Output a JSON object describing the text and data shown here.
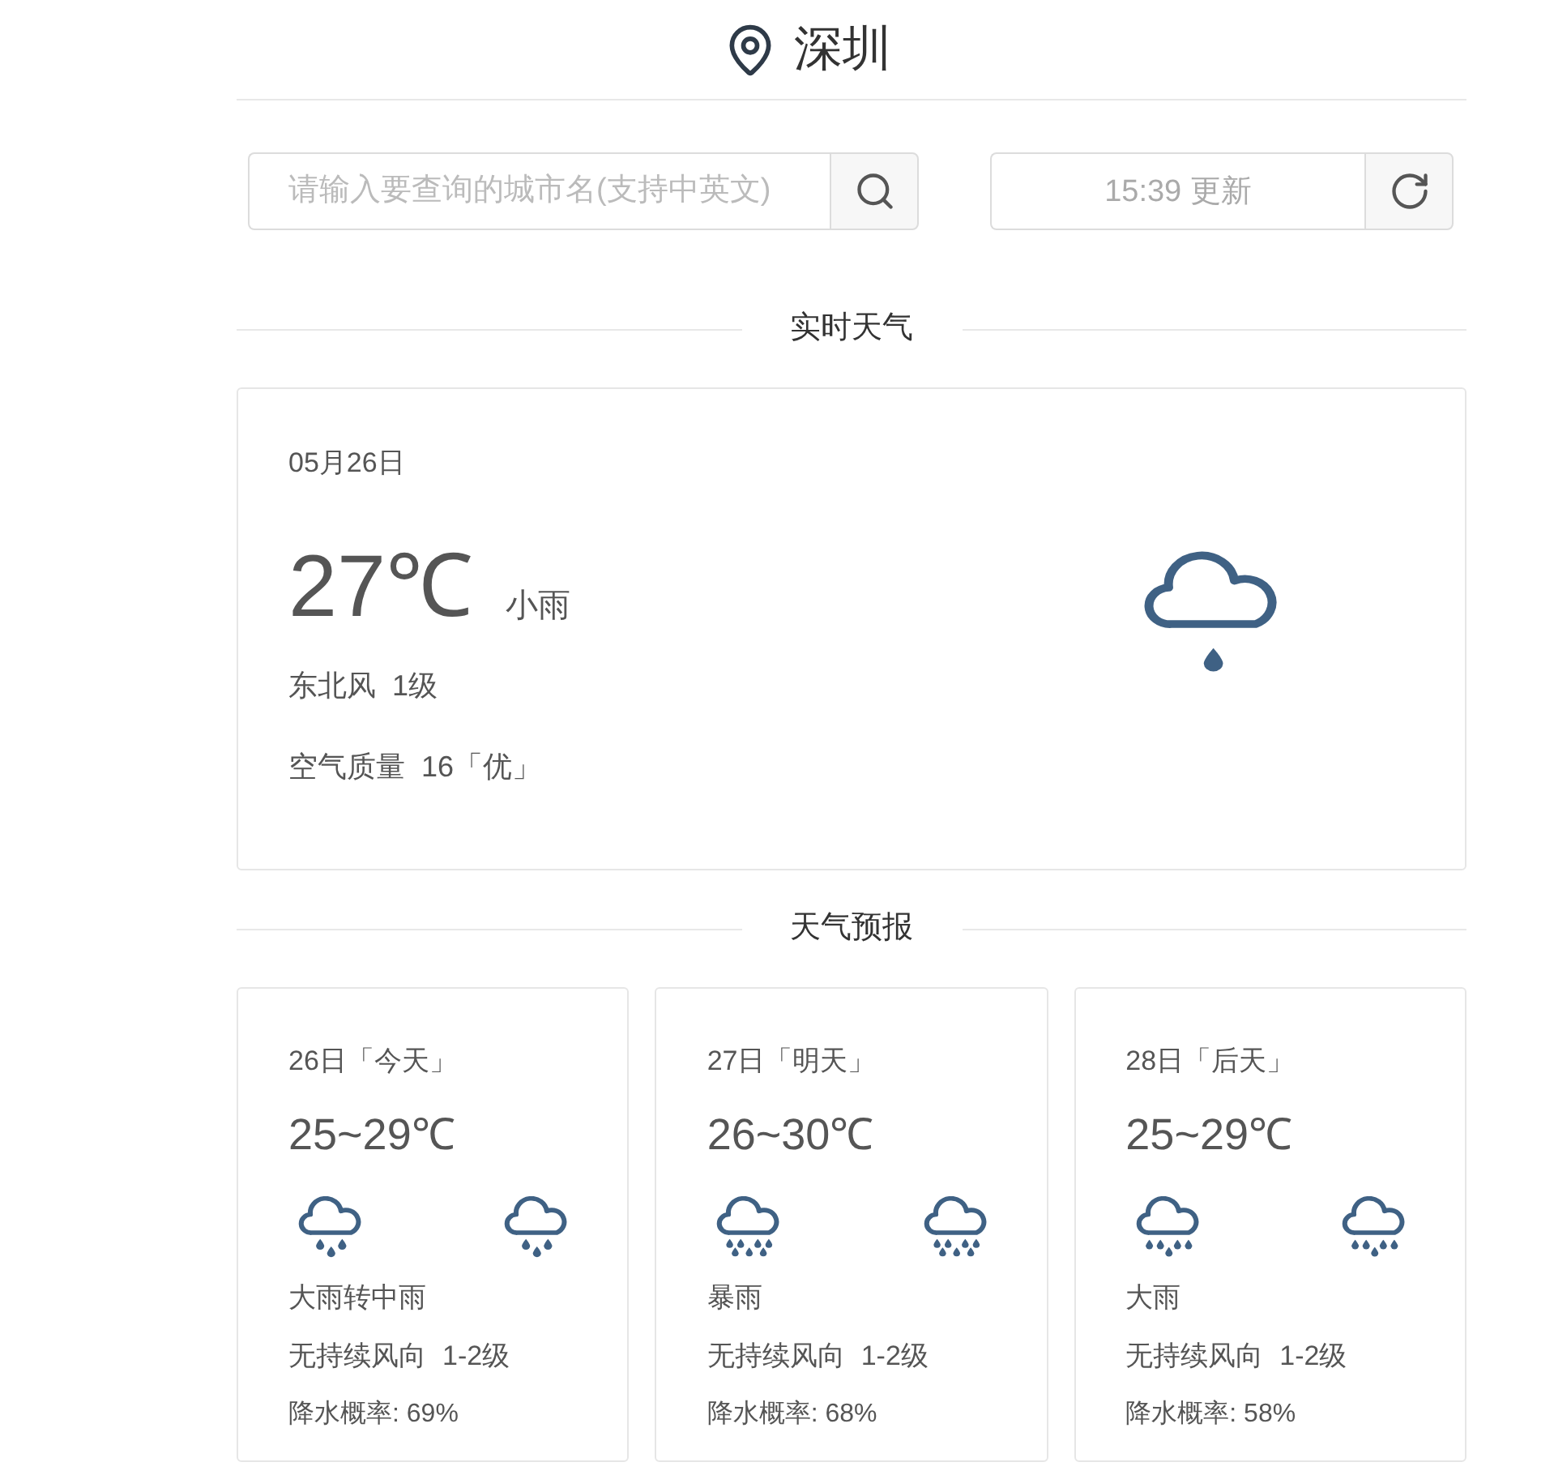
{
  "header": {
    "city": "深圳"
  },
  "search": {
    "placeholder": "请输入要查询的城市名(支持中英文)"
  },
  "update": {
    "text": "15:39 更新"
  },
  "current": {
    "section_title": "实时天气",
    "date": "05月26日",
    "temperature": "27℃",
    "condition": "小雨",
    "wind_direction": "东北风",
    "wind_level": "1级",
    "air_quality_label": "空气质量",
    "aqi": "16「优」",
    "icon": {
      "kind": "light_rain"
    }
  },
  "forecast": {
    "section_title": "天气预报",
    "days": [
      {
        "date": "26日「今天」",
        "temp_range": "25~29℃",
        "day_icon": {
          "kind": "moderate_rain"
        },
        "night_icon": {
          "kind": "moderate_rain"
        },
        "condition": "大雨转中雨",
        "wind_direction": "无持续风向",
        "wind_level": "1-2级",
        "precipitation": "降水概率: 69%"
      },
      {
        "date": "27日「明天」",
        "temp_range": "26~30℃",
        "day_icon": {
          "kind": "rainstorm"
        },
        "night_icon": {
          "kind": "rainstorm"
        },
        "condition": "暴雨",
        "wind_direction": "无持续风向",
        "wind_level": "1-2级",
        "precipitation": "降水概率: 68%"
      },
      {
        "date": "28日「后天」",
        "temp_range": "25~29℃",
        "day_icon": {
          "kind": "heavy_rain"
        },
        "night_icon": {
          "kind": "heavy_rain"
        },
        "condition": "大雨",
        "wind_direction": "无持续风向",
        "wind_level": "1-2级",
        "precipitation": "降水概率: 58%"
      }
    ]
  }
}
